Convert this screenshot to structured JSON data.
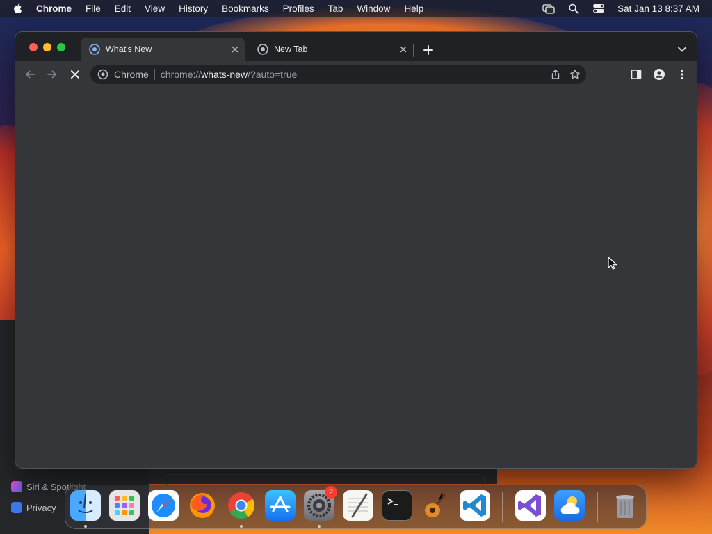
{
  "menubar": {
    "app_name": "Chrome",
    "items": [
      "File",
      "Edit",
      "View",
      "History",
      "Bookmarks",
      "Profiles",
      "Tab",
      "Window",
      "Help"
    ],
    "clock": "Sat Jan 13  8:37 AM"
  },
  "browser": {
    "tabs": [
      {
        "title": "What's New",
        "active": true
      },
      {
        "title": "New Tab",
        "active": false
      }
    ],
    "omnibox": {
      "chip": "Chrome",
      "url_scheme": "chrome://",
      "url_host": "whats-new",
      "url_rest": "/?auto=true"
    }
  },
  "background_window": {
    "sidebar_items": [
      "Siri & Spotlight",
      "Privacy"
    ]
  },
  "dock": {
    "apps": [
      {
        "name": "Finder",
        "icon": "finder-icon",
        "running": true
      },
      {
        "name": "Launchpad",
        "icon": "launchpad-icon",
        "running": false
      },
      {
        "name": "Safari",
        "icon": "safari-icon",
        "running": false
      },
      {
        "name": "Firefox",
        "icon": "firefox-icon",
        "running": false
      },
      {
        "name": "Chrome",
        "icon": "chrome-icon",
        "running": true
      },
      {
        "name": "App Store",
        "icon": "app-store-icon",
        "running": false
      },
      {
        "name": "System Settings",
        "icon": "system-settings-icon",
        "running": true,
        "badge": "2"
      },
      {
        "name": "TextEdit",
        "icon": "textedit-icon",
        "running": false
      },
      {
        "name": "Terminal",
        "icon": "terminal-icon",
        "running": false
      },
      {
        "name": "GarageBand",
        "icon": "garageband-icon",
        "running": false
      },
      {
        "name": "Visual Studio Code",
        "icon": "vscode-icon",
        "running": false
      },
      {
        "name": "Visual Studio",
        "icon": "visual-studio-icon",
        "running": false
      },
      {
        "name": "Weather",
        "icon": "weather-icon",
        "running": false
      },
      {
        "name": "Trash",
        "icon": "trash-icon",
        "running": false
      }
    ]
  },
  "colors": {
    "tab_strip": "#202124",
    "toolbar": "#35363a",
    "omnibox": "#202124",
    "badge": "#ff3b30"
  }
}
